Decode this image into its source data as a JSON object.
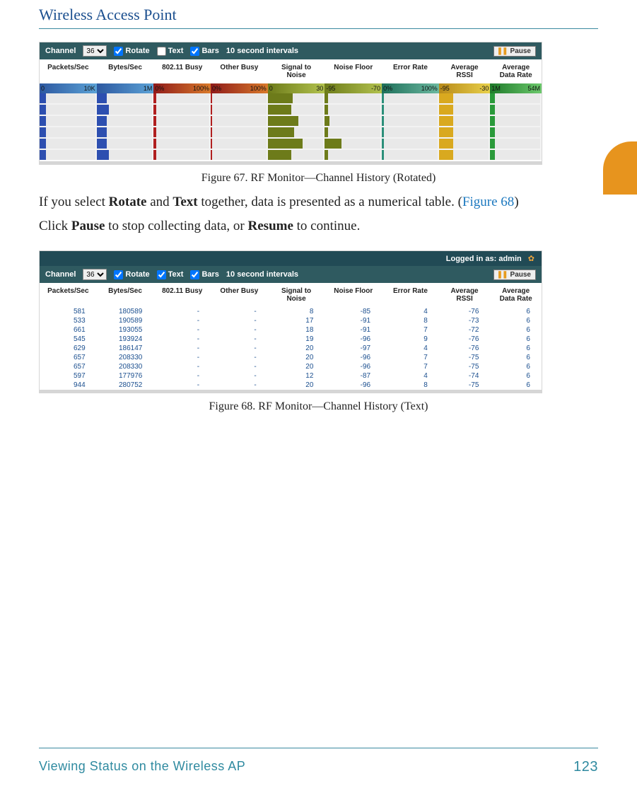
{
  "header": {
    "title": "Wireless Access Point"
  },
  "fig67": {
    "caption": "Figure 67. RF Monitor—Channel History (Rotated)",
    "toolbar": {
      "channel_label": "Channel",
      "channel_value": "36",
      "rotate_label": "Rotate",
      "text_label": "Text",
      "bars_label": "Bars",
      "interval_label": "10 second intervals",
      "pause_label": "Pause"
    },
    "columns": [
      "Packets/Sec",
      "Bytes/Sec",
      "802.11 Busy",
      "Other Busy",
      "Signal to\nNoise",
      "Noise Floor",
      "Error Rate",
      "Average\nRSSI",
      "Average\nData Rate"
    ],
    "scales": [
      {
        "lo": "0",
        "hi": "10K",
        "cls": "sc-blue"
      },
      {
        "lo": "",
        "hi": "1M",
        "cls": "sc-blue"
      },
      {
        "lo": "0%",
        "hi": "100%",
        "cls": "sc-red"
      },
      {
        "lo": "0%",
        "hi": "100%",
        "cls": "sc-red"
      },
      {
        "lo": "0",
        "hi": "30",
        "cls": "sc-olive"
      },
      {
        "lo": "-95",
        "hi": "-70",
        "cls": "sc-olive"
      },
      {
        "lo": "0%",
        "hi": "100%",
        "cls": "sc-teal"
      },
      {
        "lo": "-95",
        "hi": "-30",
        "cls": "sc-yel"
      },
      {
        "lo": "1M",
        "hi": "54M",
        "cls": "sc-grn"
      }
    ],
    "chart_data": {
      "type": "bar",
      "series_classes": [
        "c-blue",
        "c-blue",
        "c-red",
        "c-red",
        "c-olive",
        "c-olive",
        "c-teal",
        "c-yel",
        "c-grn"
      ],
      "rows": [
        [
          12,
          18,
          4,
          3,
          45,
          6,
          4,
          28,
          10
        ],
        [
          12,
          22,
          4,
          3,
          42,
          6,
          4,
          28,
          10
        ],
        [
          12,
          18,
          4,
          3,
          55,
          8,
          4,
          28,
          10
        ],
        [
          12,
          18,
          4,
          3,
          48,
          6,
          4,
          28,
          10
        ],
        [
          12,
          18,
          4,
          3,
          62,
          30,
          4,
          28,
          10
        ],
        [
          12,
          22,
          4,
          3,
          42,
          6,
          4,
          28,
          10
        ]
      ]
    }
  },
  "para1": {
    "pre": "If you select ",
    "b1": "Rotate",
    "mid1": " and ",
    "b2": "Text",
    "mid2": " together, data is presented as a numerical table. (",
    "link": "Figure 68",
    "post": ")"
  },
  "para2": {
    "pre": "Click ",
    "b1": "Pause",
    "mid": " to stop collecting data, or ",
    "b2": "Resume",
    "post": " to continue."
  },
  "fig68": {
    "caption": "Figure 68. RF Monitor—Channel History (Text)",
    "login_label": "Logged in as: admin",
    "toolbar": {
      "channel_label": "Channel",
      "channel_value": "36",
      "rotate_label": "Rotate",
      "text_label": "Text",
      "bars_label": "Bars",
      "interval_label": "10 second intervals",
      "pause_label": "Pause"
    },
    "columns": [
      "Packets/Sec",
      "Bytes/Sec",
      "802.11 Busy",
      "Other Busy",
      "Signal to\nNoise",
      "Noise Floor",
      "Error Rate",
      "Average\nRSSI",
      "Average\nData Rate"
    ],
    "chart_data": {
      "type": "table",
      "columns": [
        "Packets/Sec",
        "Bytes/Sec",
        "802.11 Busy",
        "Other Busy",
        "Signal to Noise",
        "Noise Floor",
        "Error Rate",
        "Average RSSI",
        "Average Data Rate"
      ],
      "rows": [
        [
          "581",
          "180589",
          "-",
          "-",
          "8",
          "-85",
          "4",
          "-76",
          "6"
        ],
        [
          "533",
          "190589",
          "-",
          "-",
          "17",
          "-91",
          "8",
          "-73",
          "6"
        ],
        [
          "661",
          "193055",
          "-",
          "-",
          "18",
          "-91",
          "7",
          "-72",
          "6"
        ],
        [
          "545",
          "193924",
          "-",
          "-",
          "19",
          "-96",
          "9",
          "-76",
          "6"
        ],
        [
          "629",
          "186147",
          "-",
          "-",
          "20",
          "-97",
          "4",
          "-76",
          "6"
        ],
        [
          "657",
          "208330",
          "-",
          "-",
          "20",
          "-96",
          "7",
          "-75",
          "6"
        ],
        [
          "657",
          "208330",
          "-",
          "-",
          "20",
          "-96",
          "7",
          "-75",
          "6"
        ],
        [
          "597",
          "177976",
          "-",
          "-",
          "12",
          "-87",
          "4",
          "-74",
          "6"
        ],
        [
          "944",
          "280752",
          "-",
          "-",
          "20",
          "-96",
          "8",
          "-75",
          "6"
        ]
      ]
    }
  },
  "footer": {
    "section": "Viewing Status on the Wireless AP",
    "page": "123"
  }
}
